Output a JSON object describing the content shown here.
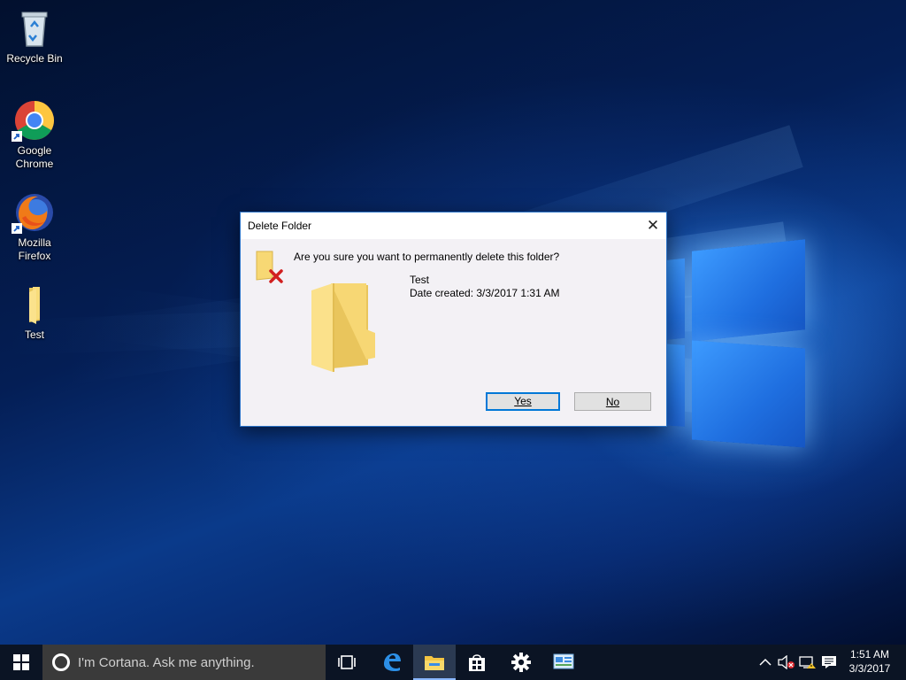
{
  "desktop": {
    "icons": [
      {
        "label": "Recycle Bin",
        "icon": "recycle-bin-icon"
      },
      {
        "label": "Google Chrome",
        "icon": "chrome-icon"
      },
      {
        "label": "Mozilla Firefox",
        "icon": "firefox-icon"
      },
      {
        "label": "Test",
        "icon": "folder-icon"
      }
    ]
  },
  "dialog": {
    "title": "Delete Folder",
    "close_glyph": "✕",
    "question": "Are you sure you want to permanently delete this folder?",
    "folder_name": "Test",
    "date_created": "Date created: 3/3/2017 1:31 AM",
    "yes_label": "Yes",
    "no_label": "No"
  },
  "taskbar": {
    "search_placeholder": "I'm Cortana. Ask me anything.",
    "pinned": [
      "task-view-icon",
      "edge-icon",
      "file-explorer-icon",
      "store-icon",
      "settings-icon",
      "control-panel-icon"
    ],
    "tray": [
      "chevron-up-icon",
      "volume-muted-icon",
      "network-icon",
      "action-center-icon"
    ],
    "clock": {
      "time": "1:51 AM",
      "date": "3/3/2017"
    }
  }
}
